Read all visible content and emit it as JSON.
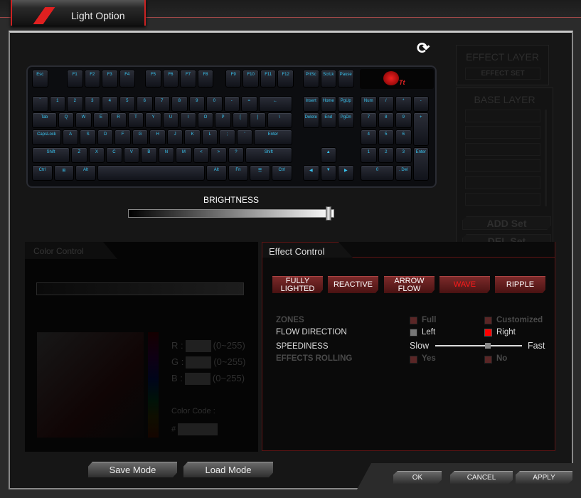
{
  "window": {
    "tab_title": "Light Option"
  },
  "keyboard": {
    "logo_text": "Tt",
    "frow": [
      "Esc",
      "F1",
      "F2",
      "F3",
      "F4",
      "F5",
      "F6",
      "F7",
      "F8",
      "F9",
      "F10",
      "F11",
      "F12",
      "PrtSc",
      "ScrLk",
      "Pause"
    ],
    "row1": [
      "`",
      "1",
      "2",
      "3",
      "4",
      "5",
      "6",
      "7",
      "8",
      "9",
      "0",
      "-",
      "=",
      "←"
    ],
    "row2": [
      "Tab",
      "Q",
      "W",
      "E",
      "R",
      "T",
      "Y",
      "U",
      "I",
      "O",
      "P",
      "[",
      "]",
      "\\"
    ],
    "row3": [
      "CapsLock",
      "A",
      "S",
      "D",
      "F",
      "G",
      "H",
      "J",
      "K",
      "L",
      ";",
      "'",
      "Enter"
    ],
    "row4": [
      "Shift",
      "Z",
      "X",
      "C",
      "V",
      "B",
      "N",
      "M",
      "<",
      ">",
      "?",
      "Shift"
    ],
    "row5": [
      "Ctrl",
      "⊞",
      "Alt",
      "",
      "Alt",
      "Fn",
      "☰",
      "Ctrl"
    ],
    "nav": [
      "Insert",
      "Home",
      "PgUp",
      "Delete",
      "End",
      "PgDn",
      "▲",
      "◀",
      "▼",
      "▶"
    ],
    "numpad": [
      "Num",
      "/",
      "*",
      "-",
      "7",
      "8",
      "9",
      "+",
      "4",
      "5",
      "6",
      "1",
      "2",
      "3",
      "Enter",
      "0",
      ". Del"
    ]
  },
  "refresh_icon": "refresh-icon",
  "brightness": {
    "label": "BRIGHTNESS",
    "value_percent": 97
  },
  "layers": {
    "effect_title": "EFFECT LAYER",
    "effect_set": "EFFECT SET",
    "base_title": "BASE LAYER",
    "add": "ADD Set",
    "del": "DEL Set"
  },
  "color_control": {
    "title": "Color Control",
    "r_label": "R :",
    "g_label": "G :",
    "b_label": "B :",
    "range": "(0~255)",
    "code_label": "Color Code :",
    "hash": "#"
  },
  "effect_control": {
    "title": "Effect Control",
    "effects": [
      "FULLY LIGHTED",
      "REACTIVE",
      "ARROW FLOW",
      "WAVE",
      "RIPPLE"
    ],
    "active_effect": "WAVE",
    "zones_label": "ZONES",
    "zones_full": "Full",
    "zones_custom": "Customized",
    "flow_label": "FLOW DIRECTION",
    "flow_left": "Left",
    "flow_right": "Right",
    "flow_selected": "Right",
    "speed_label": "SPEEDINESS",
    "speed_slow": "Slow",
    "speed_fast": "Fast",
    "speed_value_percent": 61,
    "rolling_label": "EFFECTS ROLLING",
    "rolling_yes": "Yes",
    "rolling_no": "No"
  },
  "footer": {
    "save": "Save Mode",
    "load": "Load Mode",
    "ok": "OK",
    "cancel": "CANCEL",
    "apply": "APPLY"
  },
  "colors": {
    "accent_red": "#ff1a1a",
    "key_backlight": "#38c4f0"
  }
}
